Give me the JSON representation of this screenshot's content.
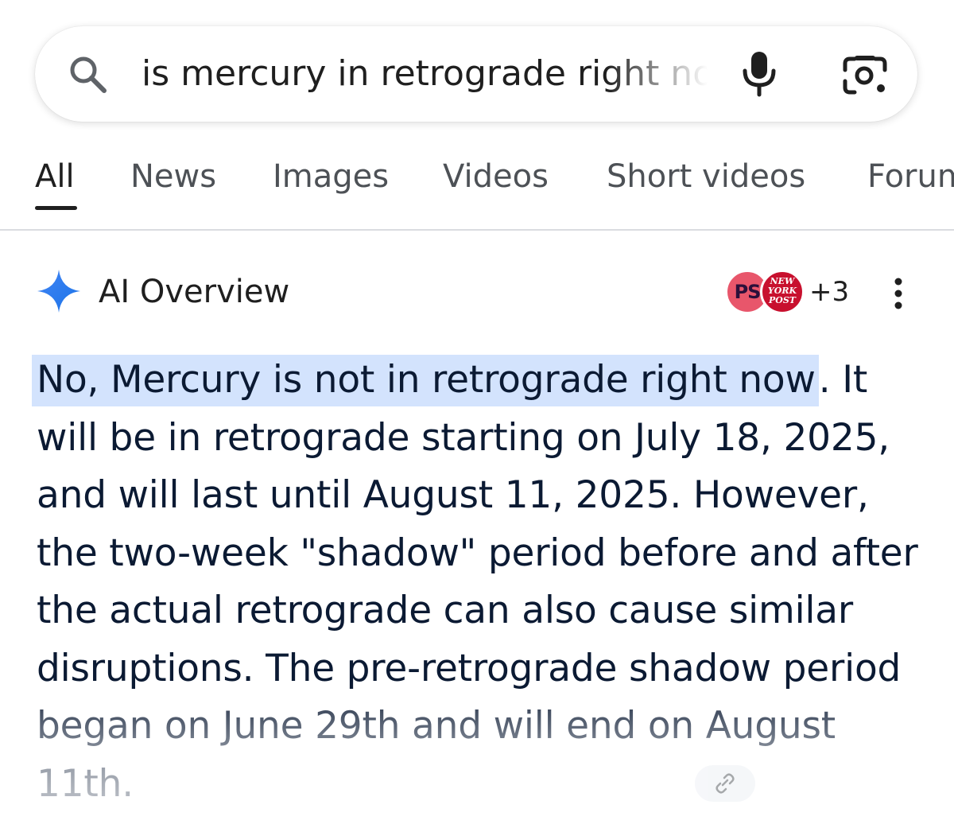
{
  "search": {
    "query": "is mercury in retrograde right now"
  },
  "tabs": [
    {
      "label": "All",
      "active": true
    },
    {
      "label": "News"
    },
    {
      "label": "Images"
    },
    {
      "label": "Videos"
    },
    {
      "label": "Short videos"
    },
    {
      "label": "Forums"
    }
  ],
  "ai_overview": {
    "title": "AI Overview",
    "sources": [
      {
        "name": "PS",
        "icon": "ps-logo"
      },
      {
        "name": "New York Post",
        "icon": "nyp-logo"
      }
    ],
    "sources_extra_count": "+3",
    "answer_highlight": "No, Mercury is not in retrograde right now",
    "answer_body": ". It will be in retrograde starting on July 18, 2025, and will last until August 11, 2025. However, the two-week \"shadow\" period before and after the actual retrograde can also cause similar disruptions. The pre-retrograde shadow period began on June 29th and will end on August 11th."
  },
  "colors": {
    "highlight": "#d3e3fd",
    "text": "#0b1a33",
    "tab_inactive": "#4d5156",
    "ai_spark": "#4285f4"
  },
  "icons": [
    "search-icon",
    "mic-icon",
    "lens-icon",
    "ai-spark-icon",
    "more-vert-icon",
    "link-icon"
  ]
}
